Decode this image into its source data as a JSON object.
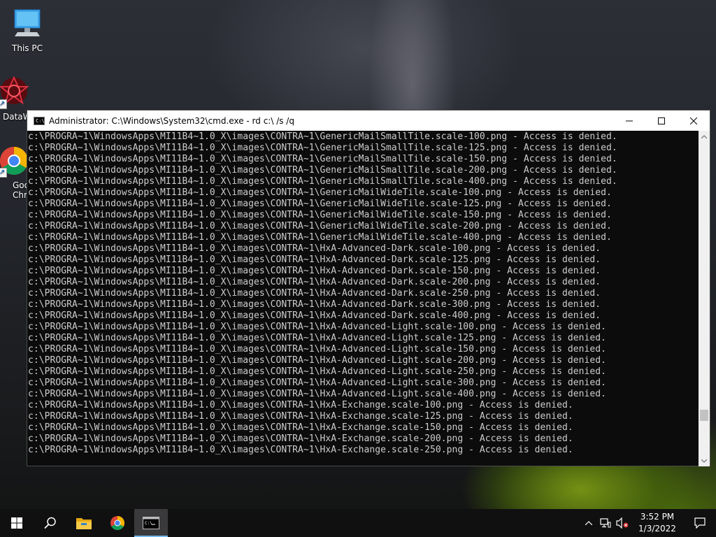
{
  "desktop": {
    "icons": [
      {
        "label": "This PC"
      },
      {
        "label": "DataW"
      },
      {
        "label": "Goo Chr"
      }
    ]
  },
  "window": {
    "title": "Administrator: C:\\Windows\\System32\\cmd.exe - rd  c:\\ /s /q",
    "icon_text": "C:\\",
    "console_lines": [
      "c:\\PROGRA~1\\WindowsApps\\MI11B4~1.0_X\\images\\CONTRA~1\\GenericMailSmallTile.scale-100.png - Access is denied.",
      "c:\\PROGRA~1\\WindowsApps\\MI11B4~1.0_X\\images\\CONTRA~1\\GenericMailSmallTile.scale-125.png - Access is denied.",
      "c:\\PROGRA~1\\WindowsApps\\MI11B4~1.0_X\\images\\CONTRA~1\\GenericMailSmallTile.scale-150.png - Access is denied.",
      "c:\\PROGRA~1\\WindowsApps\\MI11B4~1.0_X\\images\\CONTRA~1\\GenericMailSmallTile.scale-200.png - Access is denied.",
      "c:\\PROGRA~1\\WindowsApps\\MI11B4~1.0_X\\images\\CONTRA~1\\GenericMailSmallTile.scale-400.png - Access is denied.",
      "c:\\PROGRA~1\\WindowsApps\\MI11B4~1.0_X\\images\\CONTRA~1\\GenericMailWideTile.scale-100.png - Access is denied.",
      "c:\\PROGRA~1\\WindowsApps\\MI11B4~1.0_X\\images\\CONTRA~1\\GenericMailWideTile.scale-125.png - Access is denied.",
      "c:\\PROGRA~1\\WindowsApps\\MI11B4~1.0_X\\images\\CONTRA~1\\GenericMailWideTile.scale-150.png - Access is denied.",
      "c:\\PROGRA~1\\WindowsApps\\MI11B4~1.0_X\\images\\CONTRA~1\\GenericMailWideTile.scale-200.png - Access is denied.",
      "c:\\PROGRA~1\\WindowsApps\\MI11B4~1.0_X\\images\\CONTRA~1\\GenericMailWideTile.scale-400.png - Access is denied.",
      "c:\\PROGRA~1\\WindowsApps\\MI11B4~1.0_X\\images\\CONTRA~1\\HxA-Advanced-Dark.scale-100.png - Access is denied.",
      "c:\\PROGRA~1\\WindowsApps\\MI11B4~1.0_X\\images\\CONTRA~1\\HxA-Advanced-Dark.scale-125.png - Access is denied.",
      "c:\\PROGRA~1\\WindowsApps\\MI11B4~1.0_X\\images\\CONTRA~1\\HxA-Advanced-Dark.scale-150.png - Access is denied.",
      "c:\\PROGRA~1\\WindowsApps\\MI11B4~1.0_X\\images\\CONTRA~1\\HxA-Advanced-Dark.scale-200.png - Access is denied.",
      "c:\\PROGRA~1\\WindowsApps\\MI11B4~1.0_X\\images\\CONTRA~1\\HxA-Advanced-Dark.scale-250.png - Access is denied.",
      "c:\\PROGRA~1\\WindowsApps\\MI11B4~1.0_X\\images\\CONTRA~1\\HxA-Advanced-Dark.scale-300.png - Access is denied.",
      "c:\\PROGRA~1\\WindowsApps\\MI11B4~1.0_X\\images\\CONTRA~1\\HxA-Advanced-Dark.scale-400.png - Access is denied.",
      "c:\\PROGRA~1\\WindowsApps\\MI11B4~1.0_X\\images\\CONTRA~1\\HxA-Advanced-Light.scale-100.png - Access is denied.",
      "c:\\PROGRA~1\\WindowsApps\\MI11B4~1.0_X\\images\\CONTRA~1\\HxA-Advanced-Light.scale-125.png - Access is denied.",
      "c:\\PROGRA~1\\WindowsApps\\MI11B4~1.0_X\\images\\CONTRA~1\\HxA-Advanced-Light.scale-150.png - Access is denied.",
      "c:\\PROGRA~1\\WindowsApps\\MI11B4~1.0_X\\images\\CONTRA~1\\HxA-Advanced-Light.scale-200.png - Access is denied.",
      "c:\\PROGRA~1\\WindowsApps\\MI11B4~1.0_X\\images\\CONTRA~1\\HxA-Advanced-Light.scale-250.png - Access is denied.",
      "c:\\PROGRA~1\\WindowsApps\\MI11B4~1.0_X\\images\\CONTRA~1\\HxA-Advanced-Light.scale-300.png - Access is denied.",
      "c:\\PROGRA~1\\WindowsApps\\MI11B4~1.0_X\\images\\CONTRA~1\\HxA-Advanced-Light.scale-400.png - Access is denied.",
      "c:\\PROGRA~1\\WindowsApps\\MI11B4~1.0_X\\images\\CONTRA~1\\HxA-Exchange.scale-100.png - Access is denied.",
      "c:\\PROGRA~1\\WindowsApps\\MI11B4~1.0_X\\images\\CONTRA~1\\HxA-Exchange.scale-125.png - Access is denied.",
      "c:\\PROGRA~1\\WindowsApps\\MI11B4~1.0_X\\images\\CONTRA~1\\HxA-Exchange.scale-150.png - Access is denied.",
      "c:\\PROGRA~1\\WindowsApps\\MI11B4~1.0_X\\images\\CONTRA~1\\HxA-Exchange.scale-200.png - Access is denied.",
      "c:\\PROGRA~1\\WindowsApps\\MI11B4~1.0_X\\images\\CONTRA~1\\HxA-Exchange.scale-250.png - Access is denied."
    ]
  },
  "taskbar": {
    "buttons": [
      "start-icon",
      "search-icon",
      "file-explorer-icon",
      "chrome-icon",
      "cmd-icon"
    ],
    "tray_icons": [
      "chevron-up-icon",
      "network-icon",
      "volume-muted-icon"
    ],
    "time": "3:52 PM",
    "date": "1/3/2022"
  },
  "colors": {
    "console_bg": "#0c0c0c",
    "console_text": "#cccccc",
    "taskbar_bg": "#101011",
    "active_indicator": "#76b9ed"
  }
}
